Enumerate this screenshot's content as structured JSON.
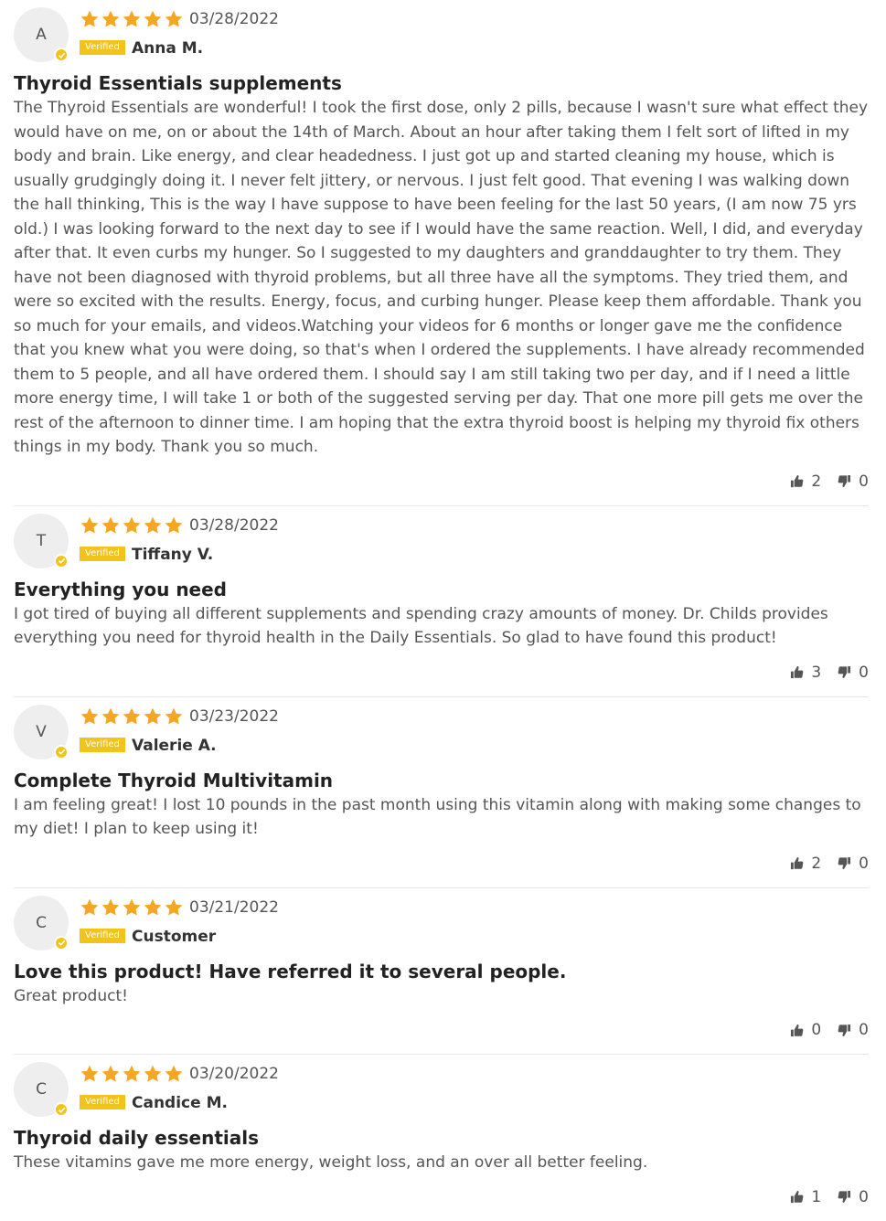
{
  "colors": {
    "star": "#f5a623",
    "verified": "#f2c31a",
    "text": "#555555",
    "title": "#222222",
    "divider": "#e6e6e6"
  },
  "reviews": [
    {
      "initial": "A",
      "rating": 5,
      "date": "03/28/2022",
      "verified_label": "Verified",
      "author": "Anna M.",
      "title": "Thyroid Essentials supplements",
      "body": "The Thyroid Essentials are wonderful! I took the first dose, only 2 pills, because I wasn't sure what effect they would have on me, on or about the 14th of March. About an hour after taking them I felt sort of lifted in my body and brain. Like energy, and clear headedness. I just got up and started cleaning my house, which is usually grudgingly doing it. I never felt jittery, or nervous. I just felt good. That evening I was walking down the hall thinking, This is the way I have suppose to have been feeling for the last 50 years, (I am now 75 yrs old.) I was looking forward to the next day to see if I would have the same reaction. Well, I did, and everyday after that. It even curbs my hunger. So I suggested to my daughters and granddaughter to try them. They have not been diagnosed with thyroid problems, but all three have all the symptoms. They tried them, and were so excited with the results. Energy, focus, and curbing hunger. Please keep them affordable. Thank you so much for your emails, and videos.Watching your videos for 6 months or longer gave me the confidence that you knew what you were doing, so that's when I ordered the supplements. I have already recommended them to 5 people, and all have ordered them. I should say I am still taking two per day, and if I need a little more energy time, I will take 1 or both of the suggested serving per day. That one more pill gets me over the rest of the afternoon to dinner time. I am hoping that the extra thyroid boost is helping my thyroid fix others things in my body. Thank you so much.",
      "upvotes": "2",
      "downvotes": "0"
    },
    {
      "initial": "T",
      "rating": 5,
      "date": "03/28/2022",
      "verified_label": "Verified",
      "author": "Tiffany V.",
      "title": "Everything you need",
      "body": "I got tired of buying all different supplements and spending crazy amounts of money. Dr. Childs provides everything you need for thyroid health in the Daily Essentials. So glad to have found this product!",
      "upvotes": "3",
      "downvotes": "0"
    },
    {
      "initial": "V",
      "rating": 5,
      "date": "03/23/2022",
      "verified_label": "Verified",
      "author": "Valerie A.",
      "title": "Complete Thyroid Multivitamin",
      "body": "I am feeling great! I lost 10 pounds in the past month using this vitamin along with making some changes to my diet! I plan to keep using it!",
      "upvotes": "2",
      "downvotes": "0"
    },
    {
      "initial": "C",
      "rating": 5,
      "date": "03/21/2022",
      "verified_label": "Verified",
      "author": "Customer",
      "title": "Love this product! Have referred it to several people.",
      "body": "Great product!",
      "upvotes": "0",
      "downvotes": "0"
    },
    {
      "initial": "C",
      "rating": 5,
      "date": "03/20/2022",
      "verified_label": "Verified",
      "author": "Candice M.",
      "title": "Thyroid daily essentials",
      "body": "These vitamins gave me more energy, weight loss, and an over all better feeling.",
      "upvotes": "1",
      "downvotes": "0"
    }
  ]
}
